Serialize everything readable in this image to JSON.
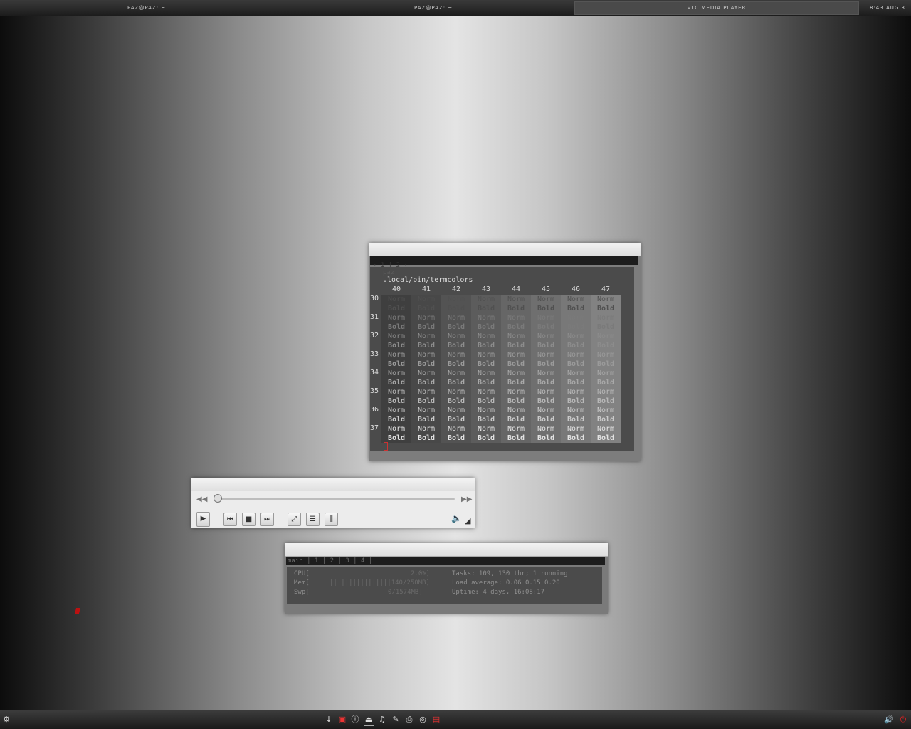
{
  "topbar": {
    "task1": "PAZ@PAZ: ~",
    "task2": "PAZ@PAZ: ~",
    "active_task": "VLC MEDIA PLAYER",
    "clock": "8:43 AUG 3"
  },
  "terminal": {
    "prompt": "paz",
    "command": ".local/bin/termcolors",
    "bg_headers": [
      "40",
      "41",
      "42",
      "43",
      "44",
      "45",
      "46",
      "47"
    ],
    "fg_rows": [
      "30",
      "31",
      "32",
      "33",
      "34",
      "35",
      "36",
      "37"
    ],
    "norm_label": "Norm",
    "bold_label": "Bold"
  },
  "vlc": {
    "title": "",
    "position_fraction": 0.0
  },
  "htop": {
    "tabs": "main | 1 | 2 | 3 | 4 |",
    "cpu_label": "CPU[",
    "cpu_value": "2.0%]",
    "mem_label": "Mem[",
    "mem_bar": "||||||||||||||||140/250MB]",
    "swp_label": "Swp[",
    "swp_value": "0/1574MB]",
    "tasks": "Tasks: 109, 130 thr; 1 running",
    "load": "Load average: 0.06 0.15 0.20",
    "uptime": "Uptime: 4 days, 16:08:17"
  },
  "colors": {
    "term_bg": "#4b4b4b",
    "accent_red": "#cc2222"
  }
}
